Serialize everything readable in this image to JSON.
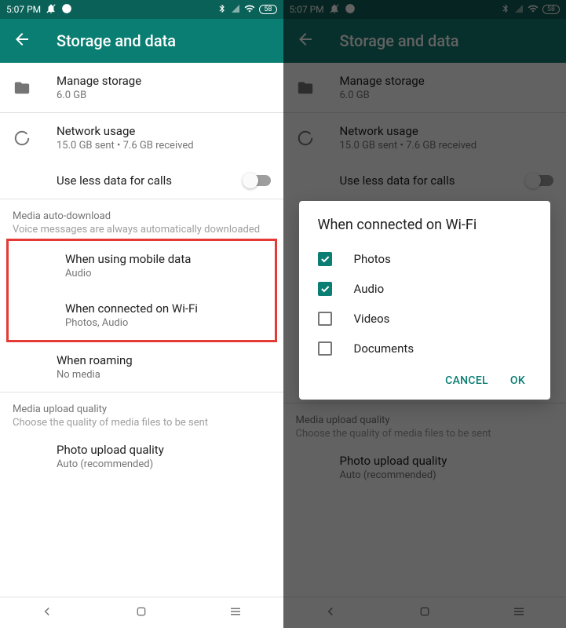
{
  "status": {
    "time": "5:07 PM",
    "battery": "58"
  },
  "header": {
    "title": "Storage and data"
  },
  "items": {
    "manage_storage": {
      "title": "Manage storage",
      "sub": "6.0 GB"
    },
    "network_usage": {
      "title": "Network usage",
      "sub": "15.0 GB sent • 7.6 GB received"
    },
    "use_less_data": {
      "title": "Use less data for calls"
    }
  },
  "sections": {
    "media_auto": {
      "title": "Media auto-download",
      "sub": "Voice messages are always automatically downloaded"
    },
    "media_upload": {
      "title": "Media upload quality",
      "sub": "Choose the quality of media files to be sent"
    }
  },
  "auto_download": {
    "mobile": {
      "title": "When using mobile data",
      "sub": "Audio"
    },
    "wifi": {
      "title": "When connected on Wi-Fi",
      "sub": "Photos, Audio"
    },
    "roaming": {
      "title": "When roaming",
      "sub": "No media"
    }
  },
  "upload": {
    "photo_quality": {
      "title": "Photo upload quality",
      "sub": "Auto (recommended)"
    }
  },
  "dialog": {
    "title": "When connected on Wi-Fi",
    "options": {
      "photos": "Photos",
      "audio": "Audio",
      "videos": "Videos",
      "documents": "Documents"
    },
    "cancel": "CANCEL",
    "ok": "OK"
  }
}
